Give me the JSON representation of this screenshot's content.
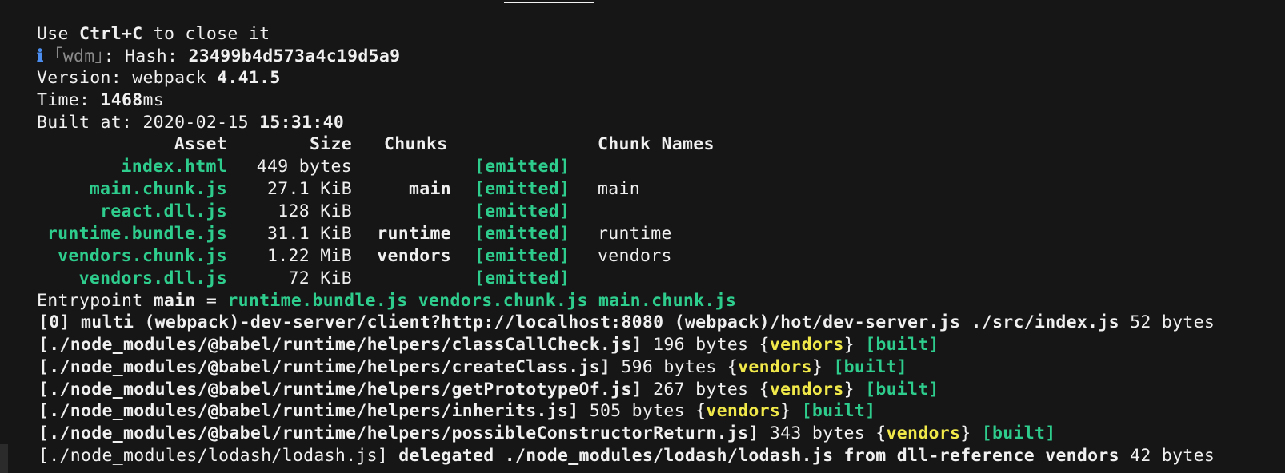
{
  "terminal": {
    "intro": {
      "prefix": "Use ",
      "key": "Ctrl+C",
      "suffix": " to close it"
    },
    "hash_line": {
      "icon": "ℹ",
      "tag": "｢wdm｣",
      "label": ": Hash: ",
      "value": "23499b4d573a4c19d5a9"
    },
    "version_line": {
      "label": "Version: webpack ",
      "value": "4.41.5"
    },
    "time_line": {
      "label": "Time: ",
      "value": "1468",
      "unit": "ms"
    },
    "built_line": {
      "label": "Built at: 2020-02-15 ",
      "value": "15:31:40"
    },
    "headers": {
      "asset": "Asset",
      "size": "Size",
      "chunks": "Chunks",
      "names": "Chunk Names"
    },
    "assets": [
      {
        "name": "index.html",
        "size": "449 bytes",
        "chunks": "",
        "status": "[emitted]",
        "chunk_names": ""
      },
      {
        "name": "main.chunk.js",
        "size": "27.1 KiB",
        "chunks": "main",
        "status": "[emitted]",
        "chunk_names": "main"
      },
      {
        "name": "react.dll.js",
        "size": "128 KiB",
        "chunks": "",
        "status": "[emitted]",
        "chunk_names": ""
      },
      {
        "name": "runtime.bundle.js",
        "size": "31.1 KiB",
        "chunks": "runtime",
        "status": "[emitted]",
        "chunk_names": "runtime"
      },
      {
        "name": "vendors.chunk.js",
        "size": "1.22 MiB",
        "chunks": "vendors",
        "status": "[emitted]",
        "chunk_names": "vendors"
      },
      {
        "name": "vendors.dll.js",
        "size": "72 KiB",
        "chunks": "",
        "status": "[emitted]",
        "chunk_names": ""
      }
    ],
    "entrypoint": {
      "label": "Entrypoint ",
      "name": "main",
      "eq": " = ",
      "files": "runtime.bundle.js vendors.chunk.js main.chunk.js"
    },
    "modules": [
      {
        "id": "[0]",
        "path": " multi (webpack)-dev-server/client?http://localhost:8080 (webpack)/hot/dev-server.js ./src/index.js",
        "size": " 52 bytes"
      },
      {
        "path": "[./node_modules/@babel/runtime/helpers/classCallCheck.js]",
        "size": " 196 bytes {",
        "chunk": "vendors",
        "close": "} ",
        "status": "[built]"
      },
      {
        "path": "[./node_modules/@babel/runtime/helpers/createClass.js]",
        "size": " 596 bytes {",
        "chunk": "vendors",
        "close": "} ",
        "status": "[built]"
      },
      {
        "path": "[./node_modules/@babel/runtime/helpers/getPrototypeOf.js]",
        "size": " 267 bytes {",
        "chunk": "vendors",
        "close": "} ",
        "status": "[built]"
      },
      {
        "path": "[./node_modules/@babel/runtime/helpers/inherits.js]",
        "size": " 505 bytes {",
        "chunk": "vendors",
        "close": "} ",
        "status": "[built]"
      },
      {
        "path": "[./node_modules/@babel/runtime/helpers/possibleConstructorReturn.js]",
        "size": " 343 bytes {",
        "chunk": "vendors",
        "close": "} ",
        "status": "[built]"
      }
    ],
    "lodash_line": {
      "path": "[./node_modules/lodash/lodash.js]",
      "rest": " delegated ./node_modules/lodash/lodash.js from dll-reference vendors",
      "size": " 42 bytes"
    },
    "colors": {
      "green": "#2ecc8d",
      "yellow": "#f1e94a",
      "info": "#4b8ef0",
      "background": "#161616"
    }
  }
}
